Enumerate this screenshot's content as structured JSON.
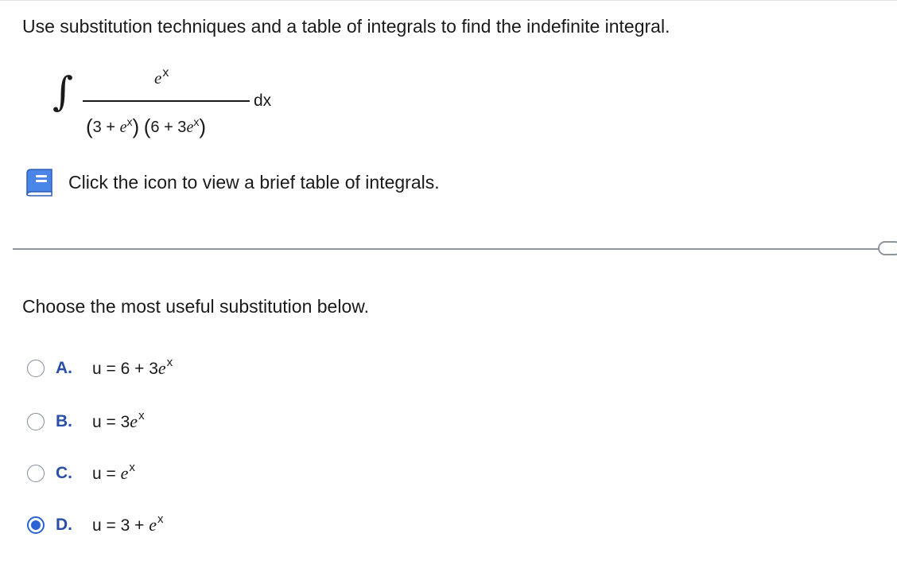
{
  "question": "Use substitution techniques and a table of integrals to find the indefinite integral.",
  "integral": {
    "sign": "∫",
    "numerator_base": "e",
    "numerator_exp": "x",
    "denominator": {
      "open1": "(",
      "t1_const": "3 + ",
      "t1_base": "e",
      "t1_exp": "x",
      "close1": ")",
      "open2": "(",
      "t2_const": "6 + 3",
      "t2_base": "e",
      "t2_exp": "x",
      "close2": ")"
    },
    "dx": "dx"
  },
  "table_link": {
    "icon": "book-icon",
    "text": "Click the icon to view a brief table of integrals."
  },
  "prompt": "Choose the most useful substitution below.",
  "options": [
    {
      "letter": "A.",
      "prefix": "u = 6 + 3",
      "base": "e",
      "exp": "x",
      "selected": false
    },
    {
      "letter": "B.",
      "prefix": "u = 3",
      "base": "e",
      "exp": "x",
      "selected": false
    },
    {
      "letter": "C.",
      "prefix": "u = ",
      "base": "e",
      "exp": "x",
      "selected": false
    },
    {
      "letter": "D.",
      "prefix": "u = 3 + ",
      "base": "e",
      "exp": "x",
      "selected": true
    }
  ],
  "colors": {
    "accent": "#2a63d4",
    "letter": "#2a4fa8",
    "icon": "#4a86e8",
    "divider": "#8e959c"
  }
}
